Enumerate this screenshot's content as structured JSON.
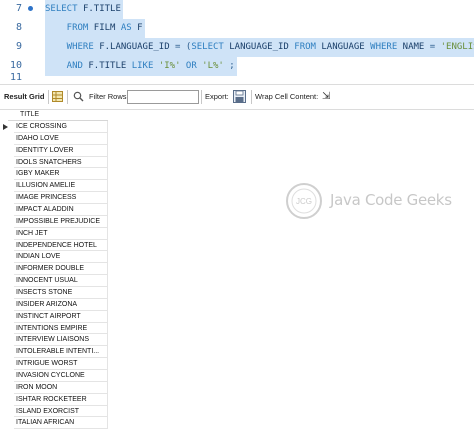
{
  "editor": {
    "lines": [
      {
        "number": "7",
        "text_parts": [
          {
            "cls": "kw",
            "t": "SELECT "
          },
          {
            "cls": "id",
            "t": "F.TITLE"
          }
        ]
      },
      {
        "number": "8",
        "text_parts": [
          {
            "cls": "kw",
            "t": "    FROM "
          },
          {
            "cls": "id",
            "t": "FILM "
          },
          {
            "cls": "kw",
            "t": "AS "
          },
          {
            "cls": "id",
            "t": "F"
          }
        ]
      },
      {
        "number": "9",
        "text_parts": [
          {
            "cls": "kw",
            "t": "    WHERE "
          },
          {
            "cls": "id",
            "t": "F.LANGUAGE_ID "
          },
          {
            "cls": "plain",
            "t": "= ("
          },
          {
            "cls": "kw",
            "t": "SELECT "
          },
          {
            "cls": "id",
            "t": "LANGUAGE_ID "
          },
          {
            "cls": "kw",
            "t": "FROM "
          },
          {
            "cls": "id",
            "t": "LANGUAGE "
          },
          {
            "cls": "kw",
            "t": "WHERE "
          },
          {
            "cls": "id",
            "t": "NAME "
          },
          {
            "cls": "plain",
            "t": "= "
          },
          {
            "cls": "str",
            "t": "'ENGLISH'"
          },
          {
            "cls": "plain",
            "t": ")"
          }
        ]
      },
      {
        "number": "10",
        "text_parts": [
          {
            "cls": "kw",
            "t": "    AND "
          },
          {
            "cls": "id",
            "t": "F.TITLE "
          },
          {
            "cls": "kw",
            "t": "LIKE "
          },
          {
            "cls": "str",
            "t": "'I%' "
          },
          {
            "cls": "kw",
            "t": "OR "
          },
          {
            "cls": "str",
            "t": "'L%'"
          },
          {
            "cls": "plain",
            "t": " ;"
          }
        ]
      },
      {
        "number": "11",
        "text_parts": []
      }
    ]
  },
  "toolbar": {
    "result_grid_label": "Result Grid",
    "filter_rows_label": "Filter Rows:",
    "filter_rows_value": "",
    "export_label": "Export:",
    "wrap_cell_label": "Wrap Cell Content:",
    "wrap_icon_glyph": "⇲"
  },
  "grid": {
    "column_header": "TITLE",
    "rows": [
      "ICE CROSSING",
      "IDAHO LOVE",
      "IDENTITY LOVER",
      "IDOLS SNATCHERS",
      "IGBY MAKER",
      "ILLUSION AMELIE",
      "IMAGE PRINCESS",
      "IMPACT ALADDIN",
      "IMPOSSIBLE PREJUDICE",
      "INCH JET",
      "INDEPENDENCE HOTEL",
      "INDIAN LOVE",
      "INFORMER DOUBLE",
      "INNOCENT USUAL",
      "INSECTS STONE",
      "INSIDER ARIZONA",
      "INSTINCT AIRPORT",
      "INTENTIONS EMPIRE",
      "INTERVIEW LIAISONS",
      "INTOLERABLE INTENTI...",
      "INTRIGUE WORST",
      "INVASION CYCLONE",
      "IRON MOON",
      "ISHTAR ROCKETEER",
      "ISLAND EXORCIST",
      "ITALIAN AFRICAN"
    ]
  },
  "watermark": {
    "logo_text": "JCG",
    "brand_text": "Java Code Geeks"
  },
  "colors": {
    "selection": "#cfe3f7",
    "keyword": "#2f7fc0",
    "line_number": "#3a6aa0"
  }
}
